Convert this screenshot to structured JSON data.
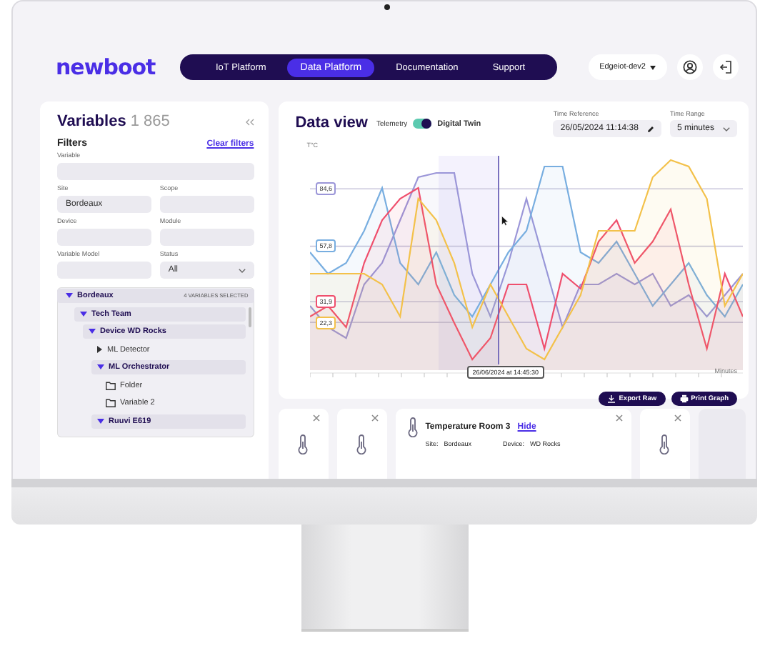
{
  "brand": "newboot",
  "nav_tabs": [
    {
      "label": "IoT Platform",
      "selected": false
    },
    {
      "label": "Data Platform",
      "selected": true
    },
    {
      "label": "Documentation",
      "selected": false
    },
    {
      "label": "Support",
      "selected": false
    }
  ],
  "environment": "Edgeiot-dev2",
  "variables_panel": {
    "title": "Variables",
    "count": "1 865",
    "filters_title": "Filters",
    "clear_filters": "Clear filters",
    "fields": [
      {
        "label": "Variable",
        "kind": "text"
      },
      {
        "label": "Site",
        "kind": "text",
        "value": "Bordeaux"
      },
      {
        "label": "Scope",
        "kind": "text"
      },
      {
        "label": "Device",
        "kind": "text"
      },
      {
        "label": "Module",
        "kind": "text"
      },
      {
        "label": "Variable Model",
        "kind": "text"
      },
      {
        "label": "Status",
        "kind": "select",
        "value": "All"
      }
    ],
    "tree": {
      "badge": "4 VARIABLES SELECTED",
      "items": [
        {
          "label": "Bordeaux",
          "kind": "group",
          "expanded": true,
          "children": [
            {
              "label": "Tech Team",
              "kind": "group",
              "expanded": true,
              "children": [
                {
                  "label": "Device WD Rocks",
                  "kind": "group",
                  "expanded": true,
                  "children": [
                    {
                      "label": "ML Detector",
                      "kind": "group",
                      "expanded": false
                    },
                    {
                      "label": "ML Orchestrator",
                      "kind": "group",
                      "expanded": true,
                      "children": [
                        {
                          "label": "Folder",
                          "kind": "folder"
                        },
                        {
                          "label": "Variable 2",
                          "kind": "folder"
                        }
                      ]
                    },
                    {
                      "label": "Ruuvi E619",
                      "kind": "group",
                      "expanded": true
                    }
                  ]
                }
              ]
            }
          ]
        }
      ]
    }
  },
  "data_view": {
    "title": "Data view",
    "telemetry_label": "Telemetry",
    "digital_twin_label": "Digital Twin",
    "digital_twin_on": true,
    "time_reference": {
      "label": "Time Reference",
      "value": "26/05/2024 11:14:38"
    },
    "time_range": {
      "label": "Time Range",
      "value": "5 minutes"
    },
    "chart_data": {
      "type": "area",
      "grid": true,
      "ylabel": "T°C",
      "xlabel": "Minutes",
      "ylim": [
        0,
        100
      ],
      "yticks": [
        {
          "value": 84.6,
          "label": "84,6"
        },
        {
          "value": 57.8,
          "label": "57,8"
        },
        {
          "value": 31.9,
          "label": "31,9"
        },
        {
          "value": 22.3,
          "label": "22,3"
        }
      ],
      "series": [
        {
          "color": "#9b96d8",
          "values": [
            30,
            20,
            15,
            40,
            50,
            70,
            90,
            92,
            92,
            45,
            25,
            50,
            80,
            50,
            20,
            40,
            40,
            45,
            40,
            45,
            30,
            35,
            25,
            35,
            45
          ]
        },
        {
          "color": "#78aee0",
          "values": [
            55,
            45,
            50,
            65,
            85,
            50,
            40,
            55,
            35,
            25,
            40,
            55,
            65,
            95,
            95,
            55,
            50,
            60,
            45,
            30,
            40,
            50,
            35,
            25,
            40
          ]
        },
        {
          "color": "#ef4f6d",
          "values": [
            25,
            30,
            20,
            50,
            70,
            80,
            85,
            40,
            22,
            5,
            15,
            40,
            40,
            10,
            45,
            38,
            60,
            70,
            50,
            60,
            75,
            40,
            10,
            45,
            25
          ]
        },
        {
          "color": "#f3c14a",
          "values": [
            45,
            45,
            45,
            45,
            40,
            25,
            80,
            70,
            50,
            20,
            40,
            25,
            10,
            5,
            20,
            35,
            65,
            65,
            65,
            90,
            98,
            95,
            80,
            30,
            45
          ]
        }
      ]
    },
    "cursor_label": "26/06/2024 at 14:45:30",
    "actions": [
      {
        "label": "Export Raw",
        "kind": "export"
      },
      {
        "label": "Print Graph",
        "kind": "print"
      }
    ]
  },
  "cards": [
    {
      "kind": "small"
    },
    {
      "kind": "small"
    },
    {
      "kind": "detail",
      "title": "Temperature Room 3",
      "hide": "Hide",
      "fields": [
        {
          "label": "Site:",
          "value": "Bordeaux"
        },
        {
          "label": "Device:",
          "value": "WD Rocks"
        }
      ]
    },
    {
      "kind": "small"
    },
    {
      "kind": "placeholder"
    }
  ]
}
